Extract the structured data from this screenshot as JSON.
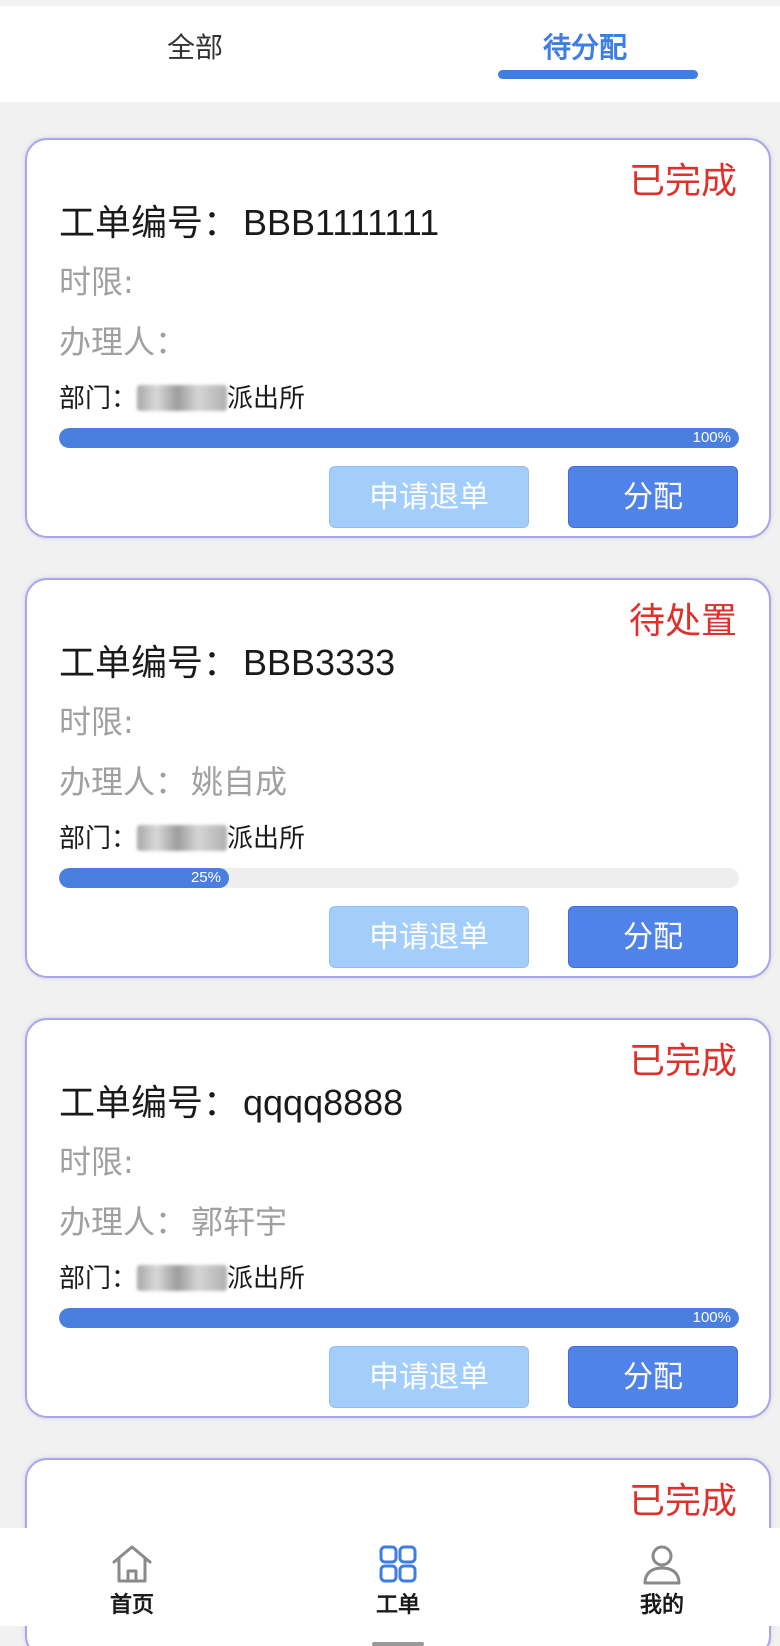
{
  "tabs": [
    {
      "label": "全部",
      "active": false
    },
    {
      "label": "待分配",
      "active": true
    }
  ],
  "labels": {
    "order_no": "工单编号：",
    "limit": "时限:",
    "handler": "办理人：",
    "dept": "部门："
  },
  "cards": [
    {
      "status": "已完成",
      "order_no": "BBB1111111",
      "limit": "",
      "handler": "",
      "dept_suffix": "派出所",
      "progress": 100,
      "progress_text": "100%",
      "return_label": "申请退单",
      "assign_label": "分配"
    },
    {
      "status": "待处置",
      "order_no": "BBB3333",
      "limit": "",
      "handler": "姚自成",
      "dept_suffix": "派出所",
      "progress": 25,
      "progress_text": "25%",
      "return_label": "申请退单",
      "assign_label": "分配"
    },
    {
      "status": "已完成",
      "order_no": "qqqq8888",
      "limit": "",
      "handler": "郭轩宇",
      "dept_suffix": "派出所",
      "progress": 100,
      "progress_text": "100%",
      "return_label": "申请退单",
      "assign_label": "分配"
    },
    {
      "status": "已完成"
    }
  ],
  "bottom_nav": [
    {
      "label": "首页",
      "icon": "home-icon",
      "active": false
    },
    {
      "label": "工单",
      "icon": "grid-icon",
      "active": true
    },
    {
      "label": "我的",
      "icon": "user-icon",
      "active": false
    }
  ],
  "colors": {
    "accent": "#3d7de4",
    "status_red": "#e0302c",
    "progress": "#4a7fe0",
    "assign_button": "#5083ea",
    "return_button": "#a3cdfb"
  }
}
